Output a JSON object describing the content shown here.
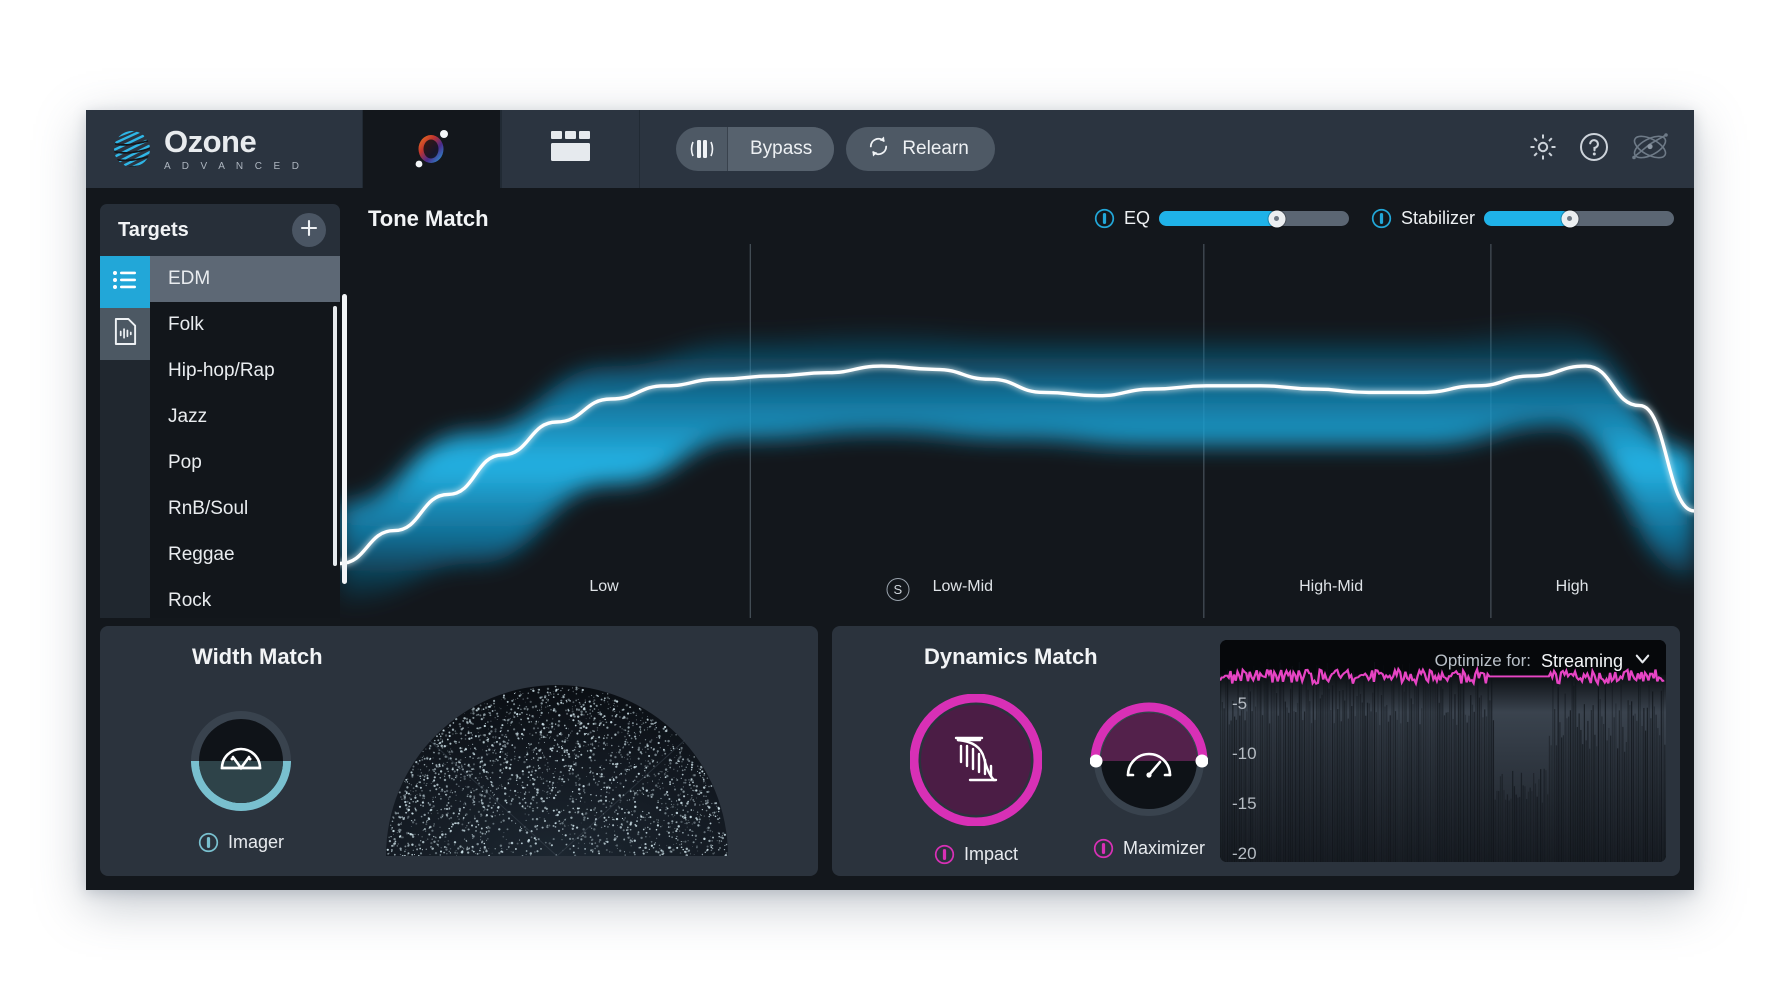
{
  "app": {
    "name": "Ozone",
    "edition": "A D V A N C E D",
    "logo_icon": "ozone-sphere-icon"
  },
  "header": {
    "tabs": [
      {
        "id": "tone-match",
        "icon": "master-assistant-orb-icon",
        "active": true
      },
      {
        "id": "modules",
        "icon": "module-grid-icon",
        "active": false
      }
    ],
    "bypass": {
      "label": "Bypass",
      "icon": "bypass-faders-icon"
    },
    "relearn": {
      "label": "Relearn",
      "icon": "refresh-circle-icon"
    },
    "right_icons": [
      {
        "id": "settings",
        "icon": "gear-icon"
      },
      {
        "id": "help",
        "icon": "question-circle-icon"
      },
      {
        "id": "izotope",
        "icon": "izotope-logo-icon"
      }
    ]
  },
  "sidebar": {
    "title": "Targets",
    "add_icon": "plus-icon",
    "rail": [
      {
        "id": "presets",
        "icon": "list-bullets-icon",
        "active": true
      },
      {
        "id": "audio-file",
        "icon": "audio-file-icon",
        "active": false
      }
    ],
    "items": [
      {
        "label": "EDM",
        "selected": true
      },
      {
        "label": "Folk",
        "selected": false
      },
      {
        "label": "Hip-hop/Rap",
        "selected": false
      },
      {
        "label": "Jazz",
        "selected": false
      },
      {
        "label": "Pop",
        "selected": false
      },
      {
        "label": "RnB/Soul",
        "selected": false
      },
      {
        "label": "Reggae",
        "selected": false
      },
      {
        "label": "Rock",
        "selected": false
      }
    ]
  },
  "tone_match": {
    "title": "Tone Match",
    "eq": {
      "label": "EQ",
      "icon": "vector-dot-icon",
      "value_pct": 62
    },
    "stabilizer": {
      "label": "Stabilizer",
      "icon": "vector-dot-icon",
      "value_pct": 45
    },
    "bands": [
      {
        "label": "Low",
        "x_pct": 19.5,
        "solo": false
      },
      {
        "label": "Low-Mid",
        "x_pct": 46.0,
        "solo": true,
        "solo_label": "S",
        "solo_x_pct": 41.2
      },
      {
        "label": "High-Mid",
        "x_pct": 73.2,
        "solo": false
      },
      {
        "label": "High",
        "x_pct": 91.0,
        "solo": false
      }
    ],
    "dividers_x_pct": [
      30.3,
      63.8,
      85.0
    ],
    "accent_color": "#1fb2e8"
  },
  "chart_data": {
    "type": "line",
    "title": "Tone Match",
    "xlabel": "",
    "ylabel": "",
    "grid": false,
    "legend": "none",
    "series": [
      {
        "name": "Target tone curve",
        "color": "#ffffff",
        "x": [
          0,
          4,
          8,
          12,
          16,
          20,
          24,
          28,
          32,
          36,
          40,
          44,
          48,
          52,
          56,
          60,
          64,
          68,
          72,
          76,
          80,
          84,
          88,
          92,
          96,
          100
        ],
        "y": [
          12,
          22,
          33,
          45,
          55,
          62,
          66,
          68,
          69,
          70,
          72,
          71,
          68,
          64,
          63,
          65,
          66,
          66,
          65,
          64,
          64,
          66,
          69,
          72,
          60,
          28
        ]
      },
      {
        "name": "Match band upper",
        "color": "#1fb2e8",
        "x": [
          0,
          10,
          20,
          30,
          40,
          50,
          60,
          70,
          80,
          90,
          100
        ],
        "y": [
          30,
          52,
          72,
          80,
          82,
          80,
          80,
          80,
          80,
          84,
          46
        ]
      },
      {
        "name": "Match band lower",
        "color": "#1fb2e8",
        "x": [
          0,
          10,
          20,
          30,
          40,
          50,
          60,
          70,
          80,
          90,
          100
        ],
        "y": [
          0,
          12,
          36,
          50,
          52,
          50,
          48,
          48,
          48,
          54,
          8
        ]
      }
    ]
  },
  "width_match": {
    "title": "Width Match",
    "knob": {
      "name": "Imager",
      "label": "Imager",
      "icon": "imager-arc-icon",
      "vector_icon": "vector-dot-icon",
      "arc_color": "#79c0cf",
      "fill_pct": 50
    },
    "vectorscope": {
      "name": "polar-vectorscope",
      "shape": "half-dome"
    }
  },
  "dynamics_match": {
    "title": "Dynamics Match",
    "knobs": [
      {
        "name": "Impact",
        "label": "Impact",
        "icon": "impact-waveform-icon",
        "vector_icon": "vector-dot-icon",
        "ring_color": "#d830b6",
        "fill_pct": 100
      },
      {
        "name": "Maximizer",
        "label": "Maximizer",
        "icon": "maximizer-gauge-icon",
        "vector_icon": "vector-dot-icon",
        "ring_color": "#d830b6",
        "fill_pct": 50
      }
    ],
    "optimize": {
      "label": "Optimize for:",
      "value": "Streaming",
      "chevron_icon": "chevron-down-icon"
    },
    "meter": {
      "scale": [
        "-5",
        "-10",
        "-15",
        "-20"
      ],
      "waveform_color": "#e744c4"
    }
  }
}
